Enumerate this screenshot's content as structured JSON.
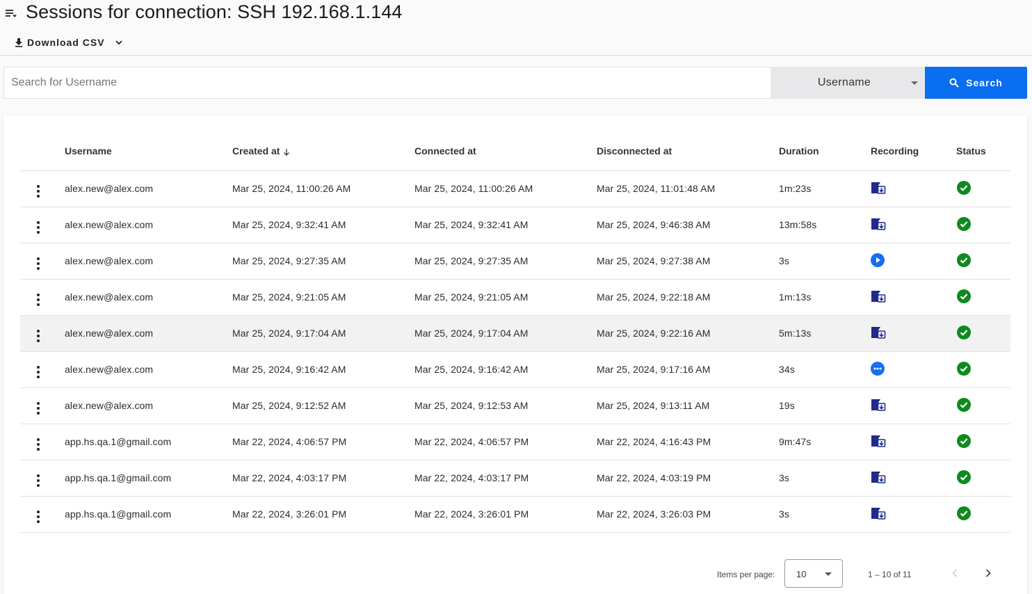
{
  "header": {
    "menu_icon": "list-filter-icon",
    "title": "Sessions for connection: SSH 192.168.1.144",
    "download_label": "Download CSV"
  },
  "search": {
    "placeholder": "Search for Username",
    "value": "",
    "field": "Username",
    "button_label": "Search"
  },
  "table": {
    "columns": [
      "Username",
      "Created at",
      "Connected at",
      "Disconnected at",
      "Duration",
      "Recording",
      "Status"
    ],
    "sort": {
      "column": "Created at",
      "direction": "descending"
    },
    "rows": [
      {
        "username": "alex.new@alex.com",
        "created": "Mar 25, 2024, 11:00:26 AM",
        "connected": "Mar 25, 2024, 11:00:26 AM",
        "disconnected": "Mar 25, 2024, 11:01:48 AM",
        "duration": "1m:23s",
        "recording": "download",
        "status": "success"
      },
      {
        "username": "alex.new@alex.com",
        "created": "Mar 25, 2024, 9:32:41 AM",
        "connected": "Mar 25, 2024, 9:32:41 AM",
        "disconnected": "Mar 25, 2024, 9:46:38 AM",
        "duration": "13m:58s",
        "recording": "download",
        "status": "success"
      },
      {
        "username": "alex.new@alex.com",
        "created": "Mar 25, 2024, 9:27:35 AM",
        "connected": "Mar 25, 2024, 9:27:35 AM",
        "disconnected": "Mar 25, 2024, 9:27:38 AM",
        "duration": "3s",
        "recording": "play",
        "status": "success"
      },
      {
        "username": "alex.new@alex.com",
        "created": "Mar 25, 2024, 9:21:05 AM",
        "connected": "Mar 25, 2024, 9:21:05 AM",
        "disconnected": "Mar 25, 2024, 9:22:18 AM",
        "duration": "1m:13s",
        "recording": "download",
        "status": "success"
      },
      {
        "username": "alex.new@alex.com",
        "created": "Mar 25, 2024, 9:17:04 AM",
        "connected": "Mar 25, 2024, 9:17:04 AM",
        "disconnected": "Mar 25, 2024, 9:22:16 AM",
        "duration": "5m:13s",
        "recording": "download",
        "status": "success",
        "highlighted": true
      },
      {
        "username": "alex.new@alex.com",
        "created": "Mar 25, 2024, 9:16:42 AM",
        "connected": "Mar 25, 2024, 9:16:42 AM",
        "disconnected": "Mar 25, 2024, 9:17:16 AM",
        "duration": "34s",
        "recording": "pending",
        "status": "success"
      },
      {
        "username": "alex.new@alex.com",
        "created": "Mar 25, 2024, 9:12:52 AM",
        "connected": "Mar 25, 2024, 9:12:53 AM",
        "disconnected": "Mar 25, 2024, 9:13:11 AM",
        "duration": "19s",
        "recording": "download",
        "status": "success"
      },
      {
        "username": "app.hs.qa.1@gmail.com",
        "created": "Mar 22, 2024, 4:06:57 PM",
        "connected": "Mar 22, 2024, 4:06:57 PM",
        "disconnected": "Mar 22, 2024, 4:16:43 PM",
        "duration": "9m:47s",
        "recording": "download",
        "status": "success"
      },
      {
        "username": "app.hs.qa.1@gmail.com",
        "created": "Mar 22, 2024, 4:03:17 PM",
        "connected": "Mar 22, 2024, 4:03:17 PM",
        "disconnected": "Mar 22, 2024, 4:03:19 PM",
        "duration": "3s",
        "recording": "download",
        "status": "success"
      },
      {
        "username": "app.hs.qa.1@gmail.com",
        "created": "Mar 22, 2024, 3:26:01 PM",
        "connected": "Mar 22, 2024, 3:26:01 PM",
        "disconnected": "Mar 22, 2024, 3:26:03 PM",
        "duration": "3s",
        "recording": "download",
        "status": "success"
      }
    ]
  },
  "paginator": {
    "items_per_page_label": "Items per page:",
    "items_per_page": "10",
    "range_label": "1 – 10 of 11"
  },
  "colors": {
    "primary": "#0a6ef0",
    "recording_icon": "#1e2a8c",
    "play_icon": "#1570ef",
    "status_success": "#0f8a1f",
    "row_highlight": "#f2f2f2"
  }
}
